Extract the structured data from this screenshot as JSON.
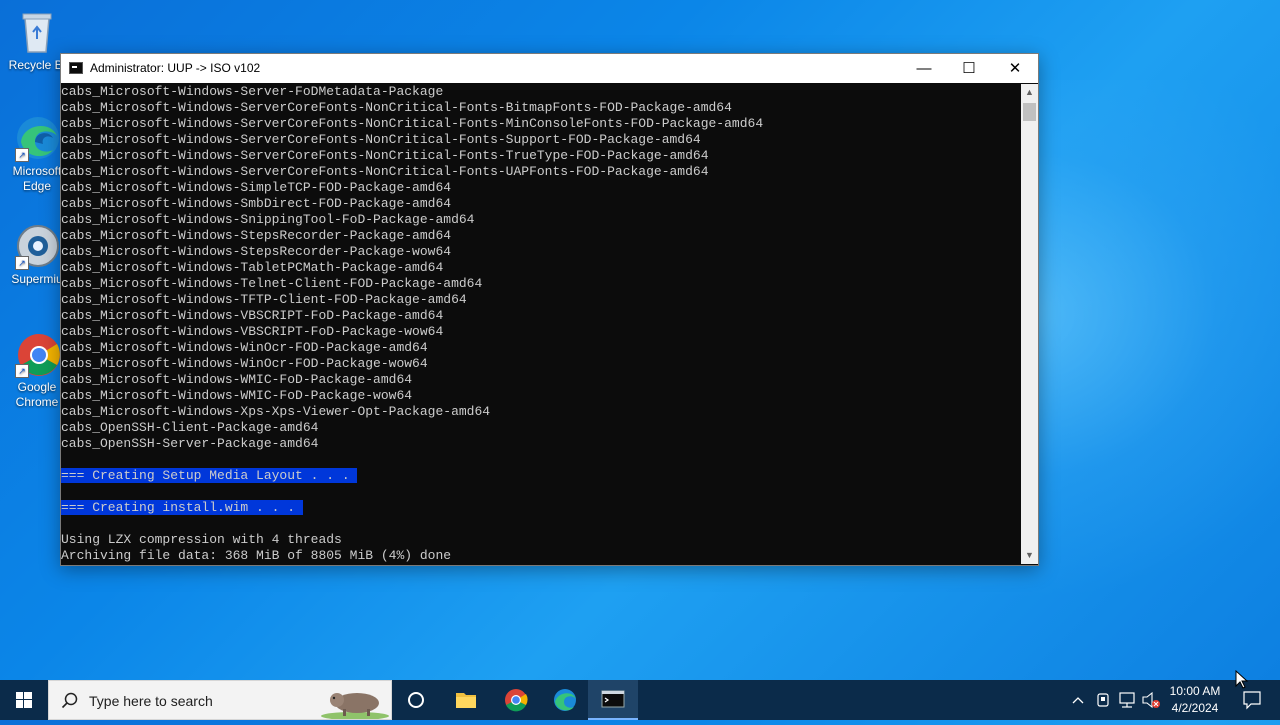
{
  "desktop": {
    "icons": [
      {
        "label": "Recycle Bi",
        "icon": "recycle-bin-icon"
      },
      {
        "label": "Microsoft Edge",
        "icon": "edge-icon"
      },
      {
        "label": "Supermiu",
        "icon": "supermium-icon"
      },
      {
        "label": "Google Chrome",
        "icon": "chrome-icon"
      }
    ]
  },
  "window": {
    "title": "Administrator:  UUP -> ISO v102",
    "buttons": {
      "minimize": "—",
      "maximize": "☐",
      "close": "✕"
    },
    "lines": [
      "cabs_Microsoft-Windows-Server-FoDMetadata-Package",
      "cabs_Microsoft-Windows-ServerCoreFonts-NonCritical-Fonts-BitmapFonts-FOD-Package-amd64",
      "cabs_Microsoft-Windows-ServerCoreFonts-NonCritical-Fonts-MinConsoleFonts-FOD-Package-amd64",
      "cabs_Microsoft-Windows-ServerCoreFonts-NonCritical-Fonts-Support-FOD-Package-amd64",
      "cabs_Microsoft-Windows-ServerCoreFonts-NonCritical-Fonts-TrueType-FOD-Package-amd64",
      "cabs_Microsoft-Windows-ServerCoreFonts-NonCritical-Fonts-UAPFonts-FOD-Package-amd64",
      "cabs_Microsoft-Windows-SimpleTCP-FOD-Package-amd64",
      "cabs_Microsoft-Windows-SmbDirect-FOD-Package-amd64",
      "cabs_Microsoft-Windows-SnippingTool-FoD-Package-amd64",
      "cabs_Microsoft-Windows-StepsRecorder-Package-amd64",
      "cabs_Microsoft-Windows-StepsRecorder-Package-wow64",
      "cabs_Microsoft-Windows-TabletPCMath-Package-amd64",
      "cabs_Microsoft-Windows-Telnet-Client-FOD-Package-amd64",
      "cabs_Microsoft-Windows-TFTP-Client-FOD-Package-amd64",
      "cabs_Microsoft-Windows-VBSCRIPT-FoD-Package-amd64",
      "cabs_Microsoft-Windows-VBSCRIPT-FoD-Package-wow64",
      "cabs_Microsoft-Windows-WinOcr-FOD-Package-amd64",
      "cabs_Microsoft-Windows-WinOcr-FOD-Package-wow64",
      "cabs_Microsoft-Windows-WMIC-FoD-Package-amd64",
      "cabs_Microsoft-Windows-WMIC-FoD-Package-wow64",
      "cabs_Microsoft-Windows-Xps-Xps-Viewer-Opt-Package-amd64",
      "cabs_OpenSSH-Client-Package-amd64",
      "cabs_OpenSSH-Server-Package-amd64",
      "",
      "=== Creating Setup Media Layout . . .",
      "",
      "=== Creating install.wim . . .",
      "",
      "Using LZX compression with 4 threads",
      "Archiving file data: 368 MiB of 8805 MiB (4%) done"
    ],
    "highlighted_lines": [
      24,
      26
    ]
  },
  "taskbar": {
    "search_placeholder": "Type here to search",
    "clock_time": "10:00 AM",
    "clock_date": "4/2/2024",
    "pinned": [
      "start-icon",
      "cortana-icon",
      "file-explorer-icon",
      "chrome-icon",
      "edge-icon",
      "command-prompt-icon"
    ]
  }
}
